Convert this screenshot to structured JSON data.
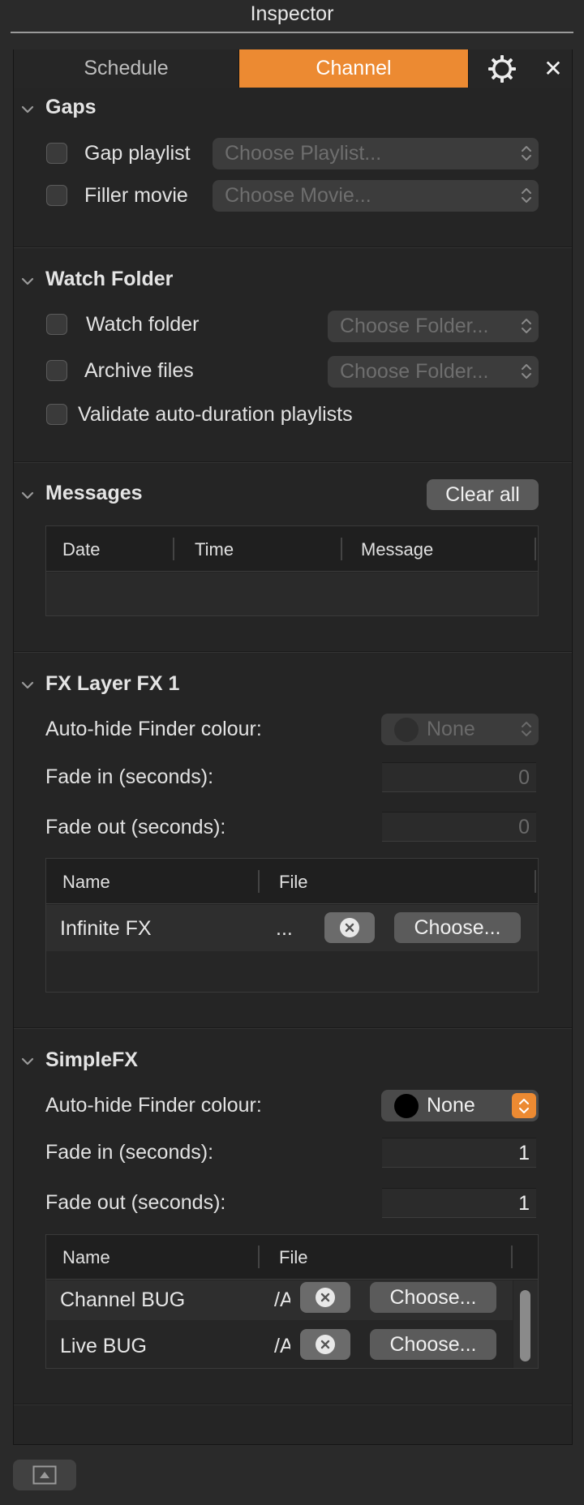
{
  "window": {
    "title": "Inspector"
  },
  "tabs": [
    {
      "label": "Schedule"
    },
    {
      "label": "Channel"
    }
  ],
  "icons": {
    "gear": "gear-icon",
    "close": "close-icon",
    "close_glyph": "✕",
    "ellipsis": "…"
  },
  "colors": {
    "accent": "#ec8a32",
    "background": "#2a2a2a"
  },
  "gaps": {
    "title": "Gaps",
    "gap_playlist": {
      "label": "Gap playlist",
      "checked": false,
      "placeholder": "Choose Playlist..."
    },
    "filler_movie": {
      "label": "Filler movie",
      "checked": false,
      "placeholder": "Choose Movie..."
    }
  },
  "watch_folder": {
    "title": "Watch Folder",
    "watch": {
      "label": "Watch folder",
      "checked": false,
      "placeholder": "Choose Folder..."
    },
    "archive": {
      "label": "Archive files",
      "checked": false,
      "placeholder": "Choose Folder..."
    },
    "validate": {
      "label": "Validate auto-duration playlists",
      "checked": false
    }
  },
  "messages": {
    "title": "Messages",
    "clear_label": "Clear all",
    "columns": [
      "Date",
      "Time",
      "Message"
    ],
    "rows": []
  },
  "fx1": {
    "title": "FX Layer FX 1",
    "autohide_label": "Auto-hide Finder colour:",
    "autohide_value": "None",
    "fade_in_label": "Fade in (seconds):",
    "fade_in_value": "0",
    "fade_out_label": "Fade out (seconds):",
    "fade_out_value": "0",
    "columns": [
      "Name",
      "File"
    ],
    "rows": [
      {
        "name": "Infinite FX",
        "file": "...",
        "choose": "Choose..."
      }
    ]
  },
  "simplefx": {
    "title": "SimpleFX",
    "autohide_label": "Auto-hide Finder colour:",
    "autohide_value": "None",
    "fade_in_label": "Fade in (seconds):",
    "fade_in_value": "1",
    "fade_out_label": "Fade out (seconds):",
    "fade_out_value": "1",
    "columns": [
      "Name",
      "File"
    ],
    "rows": [
      {
        "name": "Channel BUG",
        "file": "/A",
        "choose": "Choose..."
      },
      {
        "name": "Live BUG",
        "file": "/A",
        "choose": "Choose..."
      }
    ]
  }
}
